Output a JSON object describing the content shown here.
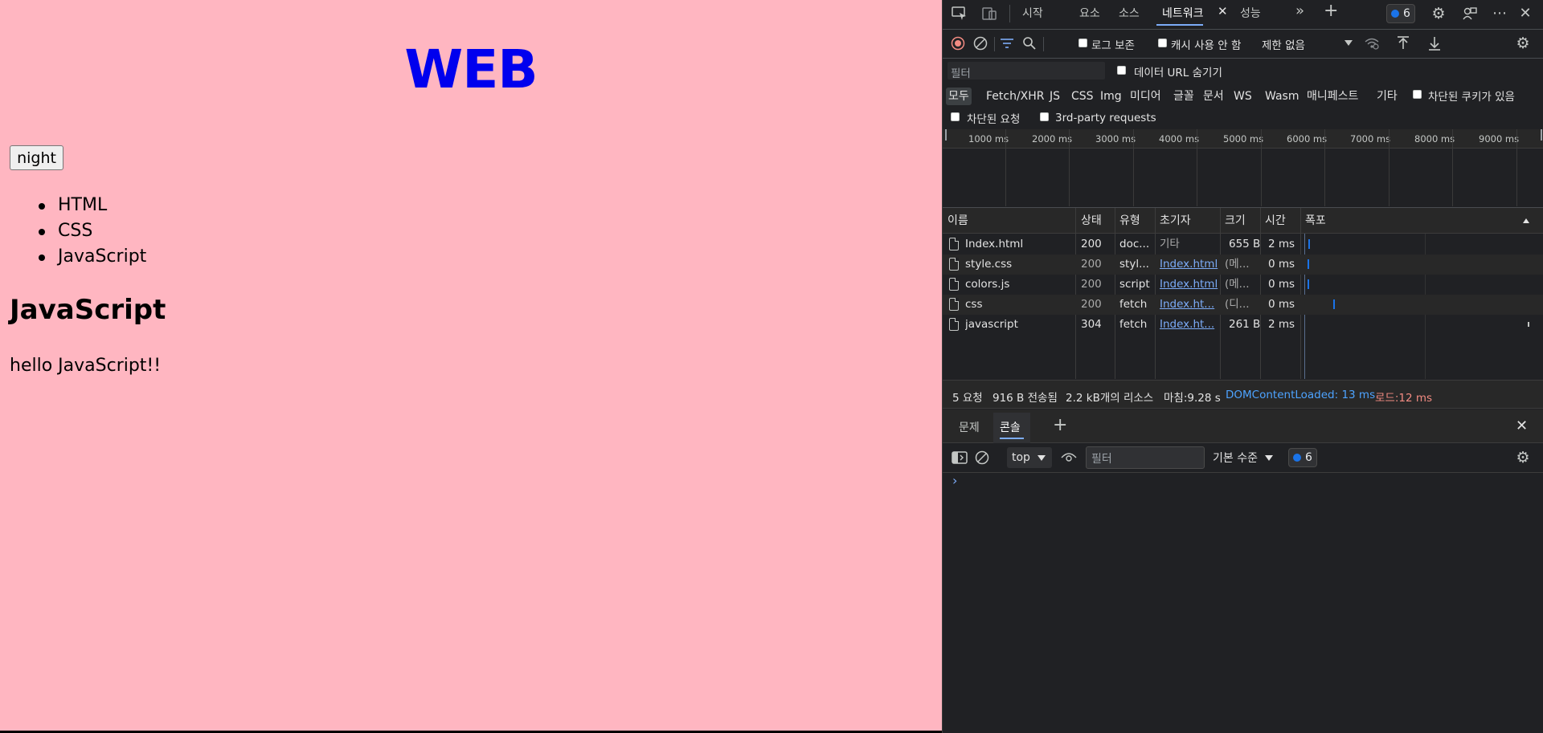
{
  "page": {
    "heading": "WEB",
    "night_button": "night",
    "topics": [
      "HTML",
      "CSS",
      "JavaScript"
    ],
    "content_title": "JavaScript",
    "content_text": "hello JavaScript!!"
  },
  "devtools": {
    "tabs": [
      "시작",
      "요소",
      "소스",
      "네트워크",
      "성능"
    ],
    "active_tab": "네트워크",
    "issue_count": "6",
    "toolbar": {
      "preserve_log": "로그 보존",
      "disable_cache": "캐시 사용 안 함",
      "throttle": "제한 없음"
    },
    "filter": {
      "placeholder": "필터",
      "hide_data_urls": "데이터 URL 숨기기",
      "types": [
        "모두",
        "Fetch/XHR",
        "JS",
        "CSS",
        "Img",
        "미디어",
        "글꼴",
        "문서",
        "WS",
        "Wasm",
        "매니페스트",
        "기타"
      ],
      "blocked_cookies": "차단된 쿠키가 있음",
      "blocked_requests": "차단된 요청",
      "third_party": "3rd-party requests"
    },
    "timeline_ticks": [
      "1000 ms",
      "2000 ms",
      "3000 ms",
      "4000 ms",
      "5000 ms",
      "6000 ms",
      "7000 ms",
      "8000 ms",
      "9000 ms"
    ],
    "table": {
      "headers": [
        "이름",
        "상태",
        "유형",
        "초기자",
        "크기",
        "시간",
        "폭포"
      ],
      "rows": [
        {
          "name": "Index.html",
          "status": "200",
          "type": "doc...",
          "initiator": "기타",
          "size": "655 B",
          "time": "2 ms"
        },
        {
          "name": "style.css",
          "status": "200",
          "type": "styl...",
          "initiator": "Index.html",
          "size": "(메...",
          "time": "0 ms"
        },
        {
          "name": "colors.js",
          "status": "200",
          "type": "script",
          "initiator": "Index.html",
          "size": "(메...",
          "time": "0 ms"
        },
        {
          "name": "css",
          "status": "200",
          "type": "fetch",
          "initiator": "Index.ht...",
          "size": "(디...",
          "time": "0 ms"
        },
        {
          "name": "javascript",
          "status": "304",
          "type": "fetch",
          "initiator": "Index.ht...",
          "size": "261 B",
          "time": "2 ms"
        }
      ]
    },
    "status": {
      "requests": "5 요청",
      "transferred": "916 B 전송됨",
      "resources": "2.2 kB개의 리소스",
      "finish": "마침:9.28 s",
      "dcl": "DOMContentLoaded: 13 ms",
      "load": "로드:12 ms"
    },
    "drawer": {
      "tabs": [
        "문제",
        "콘솔"
      ],
      "active_tab": "콘솔",
      "context": "top",
      "filter_placeholder": "필터",
      "level": "기본 수준",
      "issue_count": "6",
      "prompt": "›"
    },
    "colors": {
      "page_bg": "#ffb6c1",
      "heading": "#0000ee",
      "devtools_bg": "#202124",
      "link": "#7cacf8",
      "dcl": "#4da3ff",
      "load": "#f28b82",
      "record": "#f28b82"
    }
  }
}
